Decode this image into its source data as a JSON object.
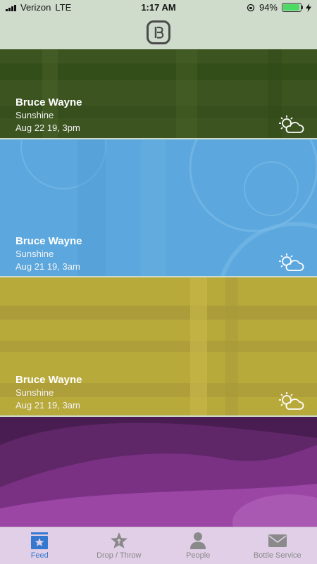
{
  "status_bar": {
    "carrier": "Verizon",
    "network": "LTE",
    "time": "1:17 AM",
    "battery": "94%"
  },
  "feed": [
    {
      "name": "Bruce Wayne",
      "subtitle": "Sunshine",
      "date": "Aug 22 19, 3pm",
      "icon": "partly-cloudy-icon",
      "color": "#3c5520"
    },
    {
      "name": "Bruce Wayne",
      "subtitle": "Sunshine",
      "date": "Aug 21 19, 3am",
      "icon": "partly-cloudy-icon",
      "color": "#5ca8de"
    },
    {
      "name": "Bruce Wayne",
      "subtitle": "Sunshine",
      "date": "Aug 21 19, 3am",
      "icon": "partly-cloudy-icon",
      "color": "#b8a93b"
    },
    {
      "name": "",
      "subtitle": "",
      "date": "",
      "icon": "",
      "color": "#5f2767"
    }
  ],
  "tabs": [
    {
      "label": "Feed",
      "icon": "feed-star-icon",
      "active": true
    },
    {
      "label": "Drop / Throw",
      "icon": "star-drop-icon",
      "active": false
    },
    {
      "label": "People",
      "icon": "person-icon",
      "active": false
    },
    {
      "label": "Bottle Service",
      "icon": "mail-icon",
      "active": false
    }
  ],
  "colors": {
    "header_bg": "#cfdccb",
    "tab_active": "#3479cf",
    "tab_inactive": "#8a8a8a",
    "tabbar_bg": "#e0cfe7"
  }
}
